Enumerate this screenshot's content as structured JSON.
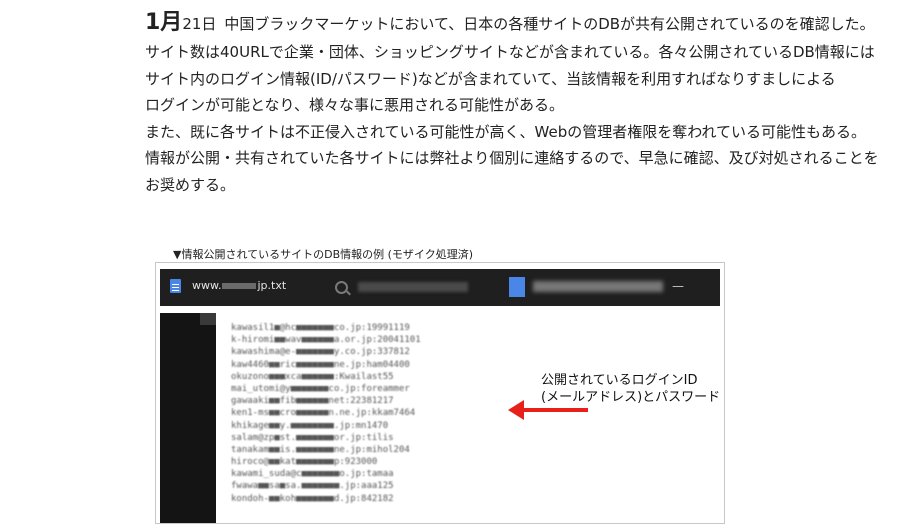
{
  "article": {
    "date_month": "1月",
    "date_day": "21日",
    "date_rest": "中国ブラックマーケットにおいて、日本の各種サイトのDBが共有公開されているのを確認した。",
    "lines": [
      "サイト数は40URLで企業・団体、ショッピングサイトなどが含まれている。各々公開されているDB情報には",
      "サイト内のログイン情報(ID/パスワード)などが含まれていて、当該情報を利用すればなりすましによる",
      "ログインが可能となり、様々な事に悪用される可能性がある。",
      "また、既に各サイトは不正侵入されている可能性が高く、Webの管理者権限を奪われている可能性もある。",
      "情報が公開・共有されていた各サイトには弊社より個別に連絡するので、早急に確認、及び対処されることを",
      "お奨めする。"
    ]
  },
  "figure": {
    "caption": "▼情報公開されているサイトのDB情報の例 (モザイク処理済)",
    "filename_prefix": "www.",
    "filename_suffix": "jp.txt",
    "lines": [
      "kawasil1■@hc■■■■■■■co.jp:19991119",
      "k-hiromi■■wav■■■■■■a.or.jp:20041101",
      "kawashima@e-■■■■■■■y.co.jp:337812",
      "kaw4460■■ric■■■■■■■ne.jp:ham04400",
      "okuzono■■■xca■■■■■■:Kwailast55",
      "mai_utomi@y■■■■■■■co.jp:foreammer",
      "gawaaki■■fib■■■■■■net:22381217",
      "ken1-ms■■cro■■■■■■n.ne.jp:kkam7464",
      "khikage■■y.■■■■■■■■.jp:mn1470",
      "salam@zp■st.■■■■■■■or.jp:tilis",
      "tanakam■■is.■■■■■■■ne.jp:mihol204",
      "hiroco@■■kat■■■■■■■p:923000",
      "kawami_suda@c■■■■■■■o.jp:tamaa",
      "fwawa■■sa■sa.■■■■■■■.jp:aaa125",
      "kondoh-■■koh■■■■■■■d.jp:842182"
    ],
    "annotation": [
      "公開されているログインID",
      "(メールアドレス)とパスワード"
    ],
    "arrow_color": "#e8201a"
  }
}
